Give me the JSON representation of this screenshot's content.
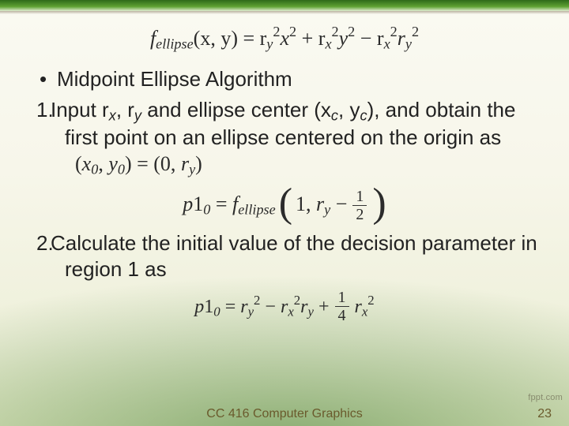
{
  "equations": {
    "definition": "f_ellipse(x, y) = r_y^2 x^2 + r_x^2 y^2 − r_x^2 r_y^2",
    "first_point": "(x_0, y_0) = (0, r_y)",
    "p1_def": "p1_0 = f_ellipse(1, r_y − 1/2)",
    "p1_value": "p1_0 = r_y^2 − r_x^2 r_y + (1/4) r_x^2"
  },
  "heading": "Midpoint Ellipse Algorithm",
  "steps": {
    "s1": {
      "num": "1.",
      "text_a": "Input r",
      "text_b": ", r",
      "text_c": "  and ellipse center (x",
      "text_d": ", y",
      "text_e": "), and obtain the first point on an ellipse centered on the origin as",
      "sub_x": "x",
      "sub_y": "y",
      "sub_c1": "c",
      "sub_c2": "c"
    },
    "s2": {
      "num": "2.",
      "text": "Calculate the initial value of the decision parameter in region 1 as"
    }
  },
  "eq1": {
    "part1": "f",
    "sub": "ellipse",
    "args": "(x, y) = r",
    "ysub": "y",
    "sq1": "2",
    "x2": "x",
    "plus1": " + r",
    "xsub": "x",
    "sq2": "2",
    "y2": "y",
    "minus": " − r",
    "xsub2": "x",
    "sq3": "2",
    "ysub2": "y",
    "sq4": "2",
    "r2": "r"
  },
  "eq2": {
    "lparen": "(",
    "x": "x",
    "z1": "0",
    "comma": ", ",
    "y": "y",
    "z2": "0",
    "rparen": ") = (0, ",
    "r": "r",
    "ys": "y",
    "close": ")"
  },
  "eq3": {
    "p": "p",
    "one": "1",
    "zero": "0",
    "eq": " = ",
    "f": "f",
    "fsub": "ellipse",
    "lp": "(",
    "a1": "1, ",
    "r": "r",
    "ys": "y",
    "minus": " − ",
    "half_n": "1",
    "half_d": "2",
    "rp": ")"
  },
  "eq4": {
    "p": "p",
    "one": "1",
    "zero": "0",
    "eq": " = ",
    "r1": "r",
    "ys1": "y",
    "sq1": "2",
    "minus1": " − ",
    "r2": "r",
    "xs1": "x",
    "sq2": "2",
    "r3": "r",
    "ys2": "y",
    "plus": " + ",
    "q_n": "1",
    "q_d": "4",
    "r4": "r",
    "xs2": "x",
    "sq3": "2"
  },
  "footer": {
    "title": "CC 416 Computer Graphics",
    "page": "23",
    "watermark": "fppt.com"
  }
}
